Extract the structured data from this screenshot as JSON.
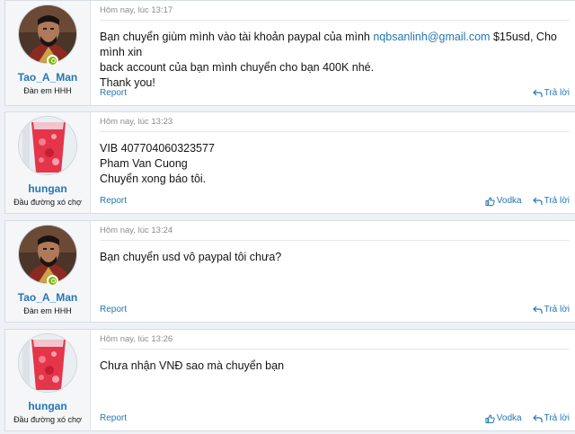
{
  "labels": {
    "report": "Report",
    "reply": "Trả lời",
    "like": "Vodka"
  },
  "colors": {
    "link": "#2577b1",
    "online": "#7fb900",
    "page_bg": "#eef1f5"
  },
  "icons": {
    "like": "thumbs-up-icon",
    "reply": "reply-arrow-icon",
    "online": "online-status-icon"
  },
  "posts": [
    {
      "author": "Tao_A_Man",
      "user_title": "Đàn em HHH",
      "time": "Hôm nay, lúc 13:17",
      "avatar": "man-portrait",
      "online": true,
      "body": {
        "line1_before": "Bạn chuyển giùm mình vào tài khoản paypal của mình ",
        "line1_link": "nqbsanlinh@gmail.com",
        "line1_after": " $15usd, Cho mình xin",
        "line2": "back account của bạn mình chuyển cho bạn 400K nhé.",
        "line3": "Thank you!"
      },
      "show_like": false
    },
    {
      "author": "hungan",
      "user_title": "Đầu đường xó chợ",
      "time": "Hôm nay, lúc 13:23",
      "avatar": "red-drink",
      "online": false,
      "body": {
        "line1": "VIB 407704060323577",
        "line2": "Pham Van Cuong",
        "line3": "Chuyển xong báo tôi."
      },
      "show_like": true
    },
    {
      "author": "Tao_A_Man",
      "user_title": "Đàn em HHH",
      "time": "Hôm nay, lúc 13:24",
      "avatar": "man-portrait",
      "online": true,
      "body": {
        "line1": "Bạn chuyển usd vô paypal tôi chưa?"
      },
      "show_like": false
    },
    {
      "author": "hungan",
      "user_title": "Đầu đường xó chợ",
      "time": "Hôm nay, lúc 13:26",
      "avatar": "red-drink",
      "online": false,
      "body": {
        "line1": "Chưa nhận VNĐ sao mà chuyển bạn"
      },
      "show_like": true
    }
  ]
}
